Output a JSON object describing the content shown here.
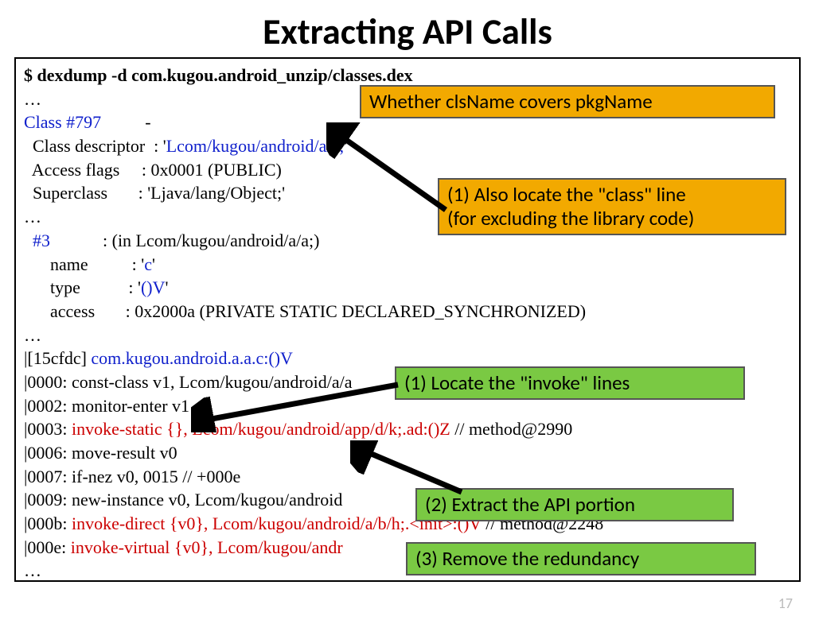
{
  "title": "Extracting API Calls",
  "cmd": "$ dexdump -d com.kugou.android_unzip/classes.dex",
  "lines": {
    "ell1": "…",
    "class_head_a": "Class #797",
    "class_head_b": "-",
    "desc_a": "Class descriptor  : '",
    "desc_b": "Lcom/kugou/android/a/a;",
    "desc_c": "'",
    "flags": "Access flags     : 0x0001 (PUBLIC)",
    "super": "Superclass       : 'Ljava/lang/Object;'",
    "ell2": "…",
    "m3_a": "#3",
    "m3_b": ": (in Lcom/kugou/android/a/a;)",
    "name_a": "name",
    "name_b": ": '",
    "name_c": "c",
    "name_d": "'",
    "type_a": "type",
    "type_b": ": '",
    "type_c": "()V",
    "type_d": "'",
    "access": "access       : 0x2000a (PRIVATE STATIC DECLARED_SYNCHRONIZED)",
    "ell3": "…",
    "hdr_a": "|[15cfdc] ",
    "hdr_b": "com.kugou.android.a.a.c:()V",
    "l0000": "|0000: const-class v1, Lcom/kugou/android/a/a",
    "l0002": "|0002: monitor-enter v1",
    "l0003_a": "|0003: ",
    "l0003_b": "invoke-static {}, Lcom/kugou/android/app/d/k;.ad:()Z",
    "l0003_c": " // method@2990",
    "l0006": "|0006: move-result v0",
    "l0007": "|0007: if-nez v0, 0015 // +000e",
    "l0009": "|0009: new-instance v0, Lcom/kugou/android",
    "l000b_a": "|000b: ",
    "l000b_b": "invoke-direct {v0}, Lcom/kugou/android/a/b/h;.<init>:()V",
    "l000b_c": " // method@2248",
    "l000e_a": "|000e: ",
    "l000e_b": "invoke-virtual {v0}, Lcom/kugou/andr",
    "ell4": "…"
  },
  "callouts": {
    "c_top": "Whether clsName covers pkgName",
    "c_mid": "(1) Also locate the \"class\" line\n(for excluding the library code)",
    "c_g1": "(1) Locate the \"invoke\" lines",
    "c_g2": "(2) Extract the API portion",
    "c_g3": "(3) Remove the redundancy"
  },
  "page_number": "17"
}
